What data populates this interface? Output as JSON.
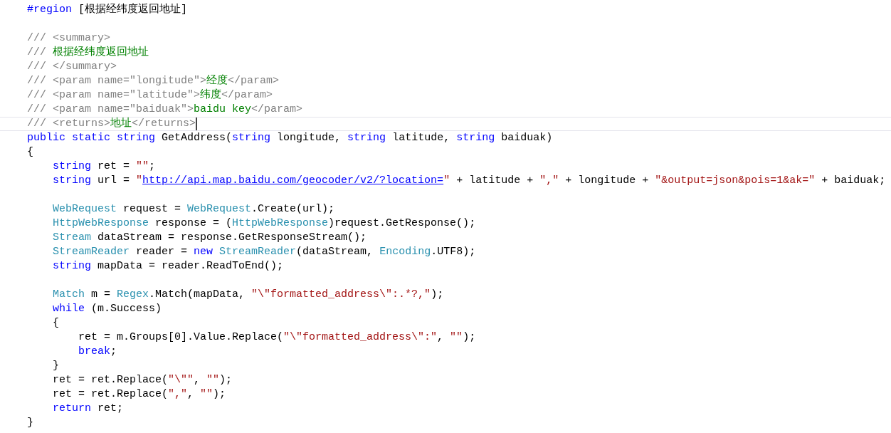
{
  "editor": {
    "lines": [
      {
        "kind": "code",
        "current": false,
        "tokens": [
          {
            "kind": "keyword",
            "text": "#region"
          },
          {
            "kind": "plain",
            "text": " [根据经纬度返回地址]"
          }
        ]
      },
      {
        "kind": "blank"
      },
      {
        "kind": "code",
        "current": false,
        "tokens": [
          {
            "kind": "comment",
            "text": "/// <summary>"
          }
        ]
      },
      {
        "kind": "code",
        "current": false,
        "tokens": [
          {
            "kind": "comment",
            "text": "/// "
          },
          {
            "kind": "doc",
            "text": "根据经纬度返回地址"
          }
        ]
      },
      {
        "kind": "code",
        "current": false,
        "tokens": [
          {
            "kind": "comment",
            "text": "/// </summary>"
          }
        ]
      },
      {
        "kind": "code",
        "current": false,
        "tokens": [
          {
            "kind": "comment",
            "text": "/// <param name=\"longitude\">"
          },
          {
            "kind": "doc",
            "text": "经度"
          },
          {
            "kind": "comment",
            "text": "</param>"
          }
        ]
      },
      {
        "kind": "code",
        "current": false,
        "tokens": [
          {
            "kind": "comment",
            "text": "/// <param name=\"latitude\">"
          },
          {
            "kind": "doc",
            "text": "纬度"
          },
          {
            "kind": "comment",
            "text": "</param>"
          }
        ]
      },
      {
        "kind": "code",
        "current": false,
        "tokens": [
          {
            "kind": "comment",
            "text": "/// <param name=\"baiduak\">"
          },
          {
            "kind": "doc",
            "text": "baidu key"
          },
          {
            "kind": "comment",
            "text": "</param>"
          }
        ]
      },
      {
        "kind": "code",
        "current": true,
        "tokens": [
          {
            "kind": "comment",
            "text": "/// <returns>"
          },
          {
            "kind": "doc",
            "text": "地址"
          },
          {
            "kind": "comment",
            "text": "</returns>"
          }
        ]
      },
      {
        "kind": "code",
        "current": false,
        "tokens": [
          {
            "kind": "keyword",
            "text": "public static string"
          },
          {
            "kind": "plain",
            "text": " GetAddress("
          },
          {
            "kind": "keyword",
            "text": "string"
          },
          {
            "kind": "plain",
            "text": " longitude, "
          },
          {
            "kind": "keyword",
            "text": "string"
          },
          {
            "kind": "plain",
            "text": " latitude, "
          },
          {
            "kind": "keyword",
            "text": "string"
          },
          {
            "kind": "plain",
            "text": " baiduak)"
          }
        ]
      },
      {
        "kind": "code",
        "current": false,
        "tokens": [
          {
            "kind": "plain",
            "text": "{"
          }
        ],
        "children": [
          {
            "kind": "code",
            "current": false,
            "tokens": [
              {
                "kind": "keyword",
                "text": "string"
              },
              {
                "kind": "plain",
                "text": " ret = "
              },
              {
                "kind": "string",
                "text": "\"\""
              },
              {
                "kind": "plain",
                "text": ";"
              }
            ]
          },
          {
            "kind": "code",
            "current": false,
            "tokens": [
              {
                "kind": "keyword",
                "text": "string"
              },
              {
                "kind": "plain",
                "text": " url = "
              },
              {
                "kind": "string",
                "text": "\""
              },
              {
                "kind": "link",
                "text": "http://api.map.baidu.com/geocoder/v2/?location="
              },
              {
                "kind": "string",
                "text": "\""
              },
              {
                "kind": "plain",
                "text": " + latitude + "
              },
              {
                "kind": "string",
                "text": "\",\""
              },
              {
                "kind": "plain",
                "text": " + longitude + "
              },
              {
                "kind": "string",
                "text": "\"&output=json&pois=1&ak=\""
              },
              {
                "kind": "plain",
                "text": " + baiduak;"
              }
            ]
          },
          {
            "kind": "blank"
          },
          {
            "kind": "code",
            "current": false,
            "tokens": [
              {
                "kind": "type",
                "text": "WebRequest"
              },
              {
                "kind": "plain",
                "text": " request = "
              },
              {
                "kind": "type",
                "text": "WebRequest"
              },
              {
                "kind": "plain",
                "text": ".Create(url);"
              }
            ]
          },
          {
            "kind": "code",
            "current": false,
            "tokens": [
              {
                "kind": "type",
                "text": "HttpWebResponse"
              },
              {
                "kind": "plain",
                "text": " response = ("
              },
              {
                "kind": "type",
                "text": "HttpWebResponse"
              },
              {
                "kind": "plain",
                "text": ")request.GetResponse();"
              }
            ]
          },
          {
            "kind": "code",
            "current": false,
            "tokens": [
              {
                "kind": "type",
                "text": "Stream"
              },
              {
                "kind": "plain",
                "text": " dataStream = response.GetResponseStream();"
              }
            ]
          },
          {
            "kind": "code",
            "current": false,
            "tokens": [
              {
                "kind": "type",
                "text": "StreamReader"
              },
              {
                "kind": "plain",
                "text": " reader = "
              },
              {
                "kind": "keyword",
                "text": "new"
              },
              {
                "kind": "type",
                "text": " StreamReader"
              },
              {
                "kind": "plain",
                "text": "(dataStream, "
              },
              {
                "kind": "type",
                "text": "Encoding"
              },
              {
                "kind": "plain",
                "text": ".UTF8);"
              }
            ]
          },
          {
            "kind": "code",
            "current": false,
            "tokens": [
              {
                "kind": "keyword",
                "text": "string"
              },
              {
                "kind": "plain",
                "text": " mapData = reader.ReadToEnd();"
              }
            ]
          },
          {
            "kind": "blank"
          },
          {
            "kind": "code",
            "current": false,
            "tokens": [
              {
                "kind": "type",
                "text": "Match"
              },
              {
                "kind": "plain",
                "text": " m = "
              },
              {
                "kind": "type",
                "text": "Regex"
              },
              {
                "kind": "plain",
                "text": ".Match(mapData, "
              },
              {
                "kind": "string",
                "text": "\"\\\"formatted_address\\\":.*?,\""
              },
              {
                "kind": "plain",
                "text": ");"
              }
            ]
          },
          {
            "kind": "code",
            "current": false,
            "tokens": [
              {
                "kind": "keyword",
                "text": "while"
              },
              {
                "kind": "plain",
                "text": " (m.Success)"
              }
            ]
          },
          {
            "kind": "code",
            "current": false,
            "tokens": [
              {
                "kind": "plain",
                "text": "{"
              }
            ],
            "children": [
              {
                "kind": "code",
                "current": false,
                "tokens": [
                  {
                    "kind": "plain",
                    "text": "ret = m.Groups[0].Value.Replace("
                  },
                  {
                    "kind": "string",
                    "text": "\"\\\"formatted_address\\\":\""
                  },
                  {
                    "kind": "plain",
                    "text": ", "
                  },
                  {
                    "kind": "string",
                    "text": "\"\""
                  },
                  {
                    "kind": "plain",
                    "text": ");"
                  }
                ]
              },
              {
                "kind": "code",
                "current": false,
                "tokens": [
                  {
                    "kind": "keyword",
                    "text": "break"
                  },
                  {
                    "kind": "plain",
                    "text": ";"
                  }
                ]
              }
            ]
          },
          {
            "kind": "code",
            "current": false,
            "tokens": [
              {
                "kind": "plain",
                "text": "}"
              }
            ]
          },
          {
            "kind": "code",
            "current": false,
            "tokens": [
              {
                "kind": "plain",
                "text": "ret = ret.Replace("
              },
              {
                "kind": "string",
                "text": "\"\\\"\""
              },
              {
                "kind": "plain",
                "text": ", "
              },
              {
                "kind": "string",
                "text": "\"\""
              },
              {
                "kind": "plain",
                "text": ");"
              }
            ]
          },
          {
            "kind": "code",
            "current": false,
            "tokens": [
              {
                "kind": "plain",
                "text": "ret = ret.Replace("
              },
              {
                "kind": "string",
                "text": "\",\""
              },
              {
                "kind": "plain",
                "text": ", "
              },
              {
                "kind": "string",
                "text": "\"\""
              },
              {
                "kind": "plain",
                "text": ");"
              }
            ]
          },
          {
            "kind": "code",
            "current": false,
            "tokens": [
              {
                "kind": "keyword",
                "text": "return"
              },
              {
                "kind": "plain",
                "text": " ret;"
              }
            ]
          }
        ]
      },
      {
        "kind": "code",
        "current": false,
        "tokens": [
          {
            "kind": "plain",
            "text": "}"
          }
        ]
      }
    ]
  }
}
